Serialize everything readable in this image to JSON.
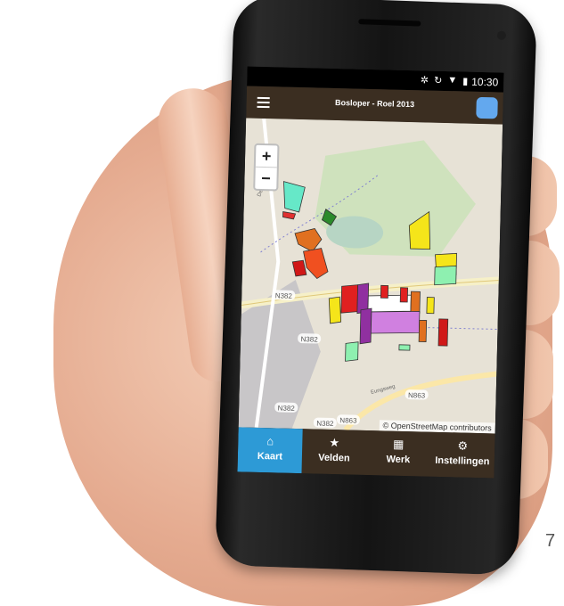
{
  "status_bar": {
    "icons": [
      "bluetooth-icon",
      "sync-icon",
      "wifi-icon",
      "battery-icon"
    ],
    "time": "10:30"
  },
  "app_bar": {
    "title": "Bosloper - Roel 2013",
    "menu_icon": "hamburger-menu-icon",
    "user_badge_color": "#63a8ee"
  },
  "map": {
    "zoom_in_label": "+",
    "zoom_out_label": "−",
    "attribution": "© OpenStreetMap contributors",
    "road_labels": [
      "N382",
      "N382",
      "N382",
      "N382",
      "N863",
      "N863",
      "Eungsweg",
      "De"
    ]
  },
  "tabs": [
    {
      "label": "Kaart",
      "icon": "home-icon",
      "active": true
    },
    {
      "label": "Velden",
      "icon": "star-icon",
      "active": false
    },
    {
      "label": "Werk",
      "icon": "grid-icon",
      "active": false
    },
    {
      "label": "Instellingen",
      "icon": "gear-icon",
      "active": false
    }
  ],
  "page_number": "7",
  "colors": {
    "app_bar": "#3b2e21",
    "active_tab": "#2d9ad6",
    "map_bg": "#e7e2d6"
  }
}
